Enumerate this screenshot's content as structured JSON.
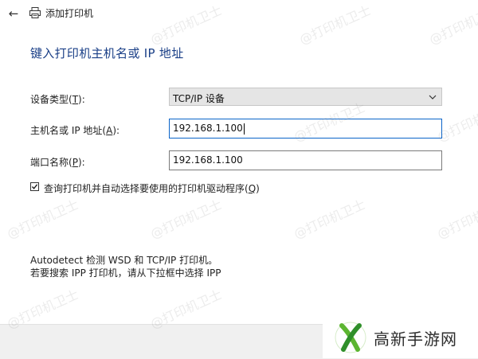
{
  "window": {
    "title": "添加打印机"
  },
  "page": {
    "heading": "键入打印机主机名或 IP 地址"
  },
  "form": {
    "device_type": {
      "label_pre": "设备类型(",
      "label_key": "T",
      "label_post": "):",
      "value": "TCP/IP 设备"
    },
    "hostname": {
      "label_pre": "主机名或 IP 地址(",
      "label_key": "A",
      "label_post": "):",
      "value": "192.168.1.100"
    },
    "port_name": {
      "label_pre": "端口名称(",
      "label_key": "P",
      "label_post": "):",
      "value": "192.168.1.100"
    },
    "query_checkbox": {
      "label_pre": "查询打印机并自动选择要使用的打印机驱动程序(",
      "label_key": "Q",
      "label_post": ")",
      "checked": true
    }
  },
  "info": {
    "line1": "Autodetect 检测 WSD 和 TCP/IP 打印机。",
    "line2": "若要搜索 IPP 打印机，请从下拉框中选择 IPP"
  },
  "watermark": {
    "text": "@打印机卫士"
  },
  "badge": {
    "text": "高新手游网"
  },
  "icons": {
    "back": "back-arrow-icon",
    "window": "printer-icon",
    "dropdown": "chevron-down-icon",
    "badge": "site-logo-icon"
  },
  "colors": {
    "heading": "#1a3f87",
    "focus_border": "#0a64c9",
    "badge_logo_green": "#5cb531"
  }
}
